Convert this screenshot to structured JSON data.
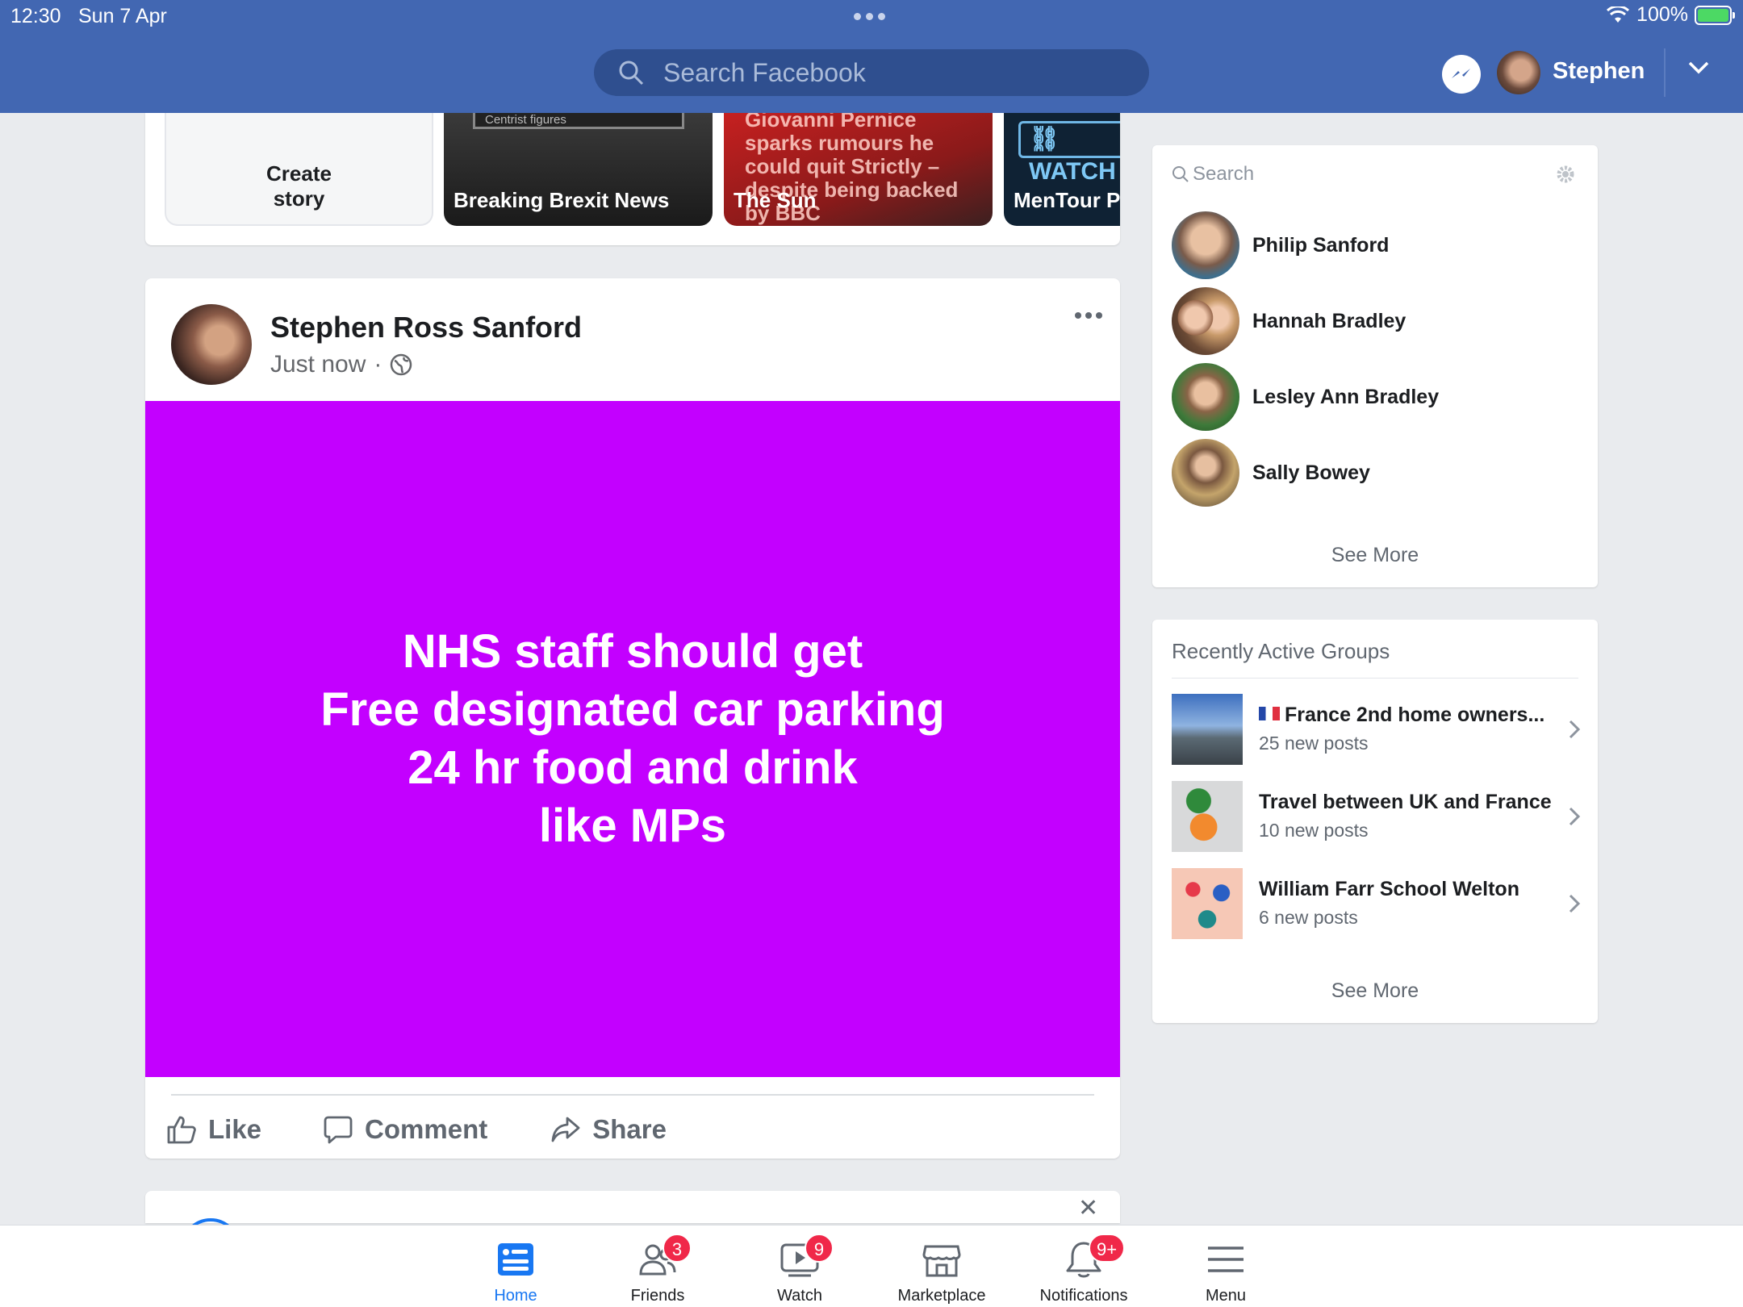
{
  "status_bar": {
    "time": "12:30",
    "date": "Sun 7 Apr",
    "battery": "100%"
  },
  "header": {
    "search_placeholder": "Search Facebook",
    "username": "Stephen"
  },
  "stories": {
    "create_label": "Create\nstory",
    "items": [
      {
        "label": "Breaking Brexit News",
        "thumb_caption": "Centrist figures"
      },
      {
        "label": "The Sun",
        "headline": "Giovanni Pernice sparks rumours he could quit Strictly – despite being backed by BBC"
      },
      {
        "label": "MenTour Pi",
        "badge": "WATCH"
      }
    ]
  },
  "post": {
    "author": "Stephen Ross Sanford",
    "time": "Just now",
    "separator": "·",
    "text_lines": [
      "NHS staff should get",
      "Free designated car parking",
      "24 hr food and drink",
      "like MPs"
    ],
    "background_color": "#c300ff",
    "actions": {
      "like": "Like",
      "comment": "Comment",
      "share": "Share"
    }
  },
  "contacts": {
    "search_placeholder": "Search",
    "items": [
      {
        "name": "Philip Sanford"
      },
      {
        "name": "Hannah Bradley"
      },
      {
        "name": "Lesley Ann Bradley"
      },
      {
        "name": "Sally Bowey"
      }
    ],
    "see_more": "See More"
  },
  "groups": {
    "title": "Recently Active Groups",
    "items": [
      {
        "name": "France 2nd home owners...",
        "sub": "25 new posts",
        "flag": "french-flag"
      },
      {
        "name": "Travel between UK and France",
        "sub": "10 new posts"
      },
      {
        "name": "William Farr School Welton",
        "sub": "6 new posts"
      }
    ],
    "see_more": "See More"
  },
  "bottom_nav": {
    "tabs": [
      {
        "label": "Home",
        "badge": ""
      },
      {
        "label": "Friends",
        "badge": "3"
      },
      {
        "label": "Watch",
        "badge": "9"
      },
      {
        "label": "Marketplace",
        "badge": ""
      },
      {
        "label": "Notifications",
        "badge": "9+"
      },
      {
        "label": "Menu",
        "badge": ""
      }
    ]
  },
  "colors": {
    "brand": "#4267b2",
    "accent": "#1877f2",
    "badge": "#f02849",
    "post_bg": "#c300ff"
  }
}
